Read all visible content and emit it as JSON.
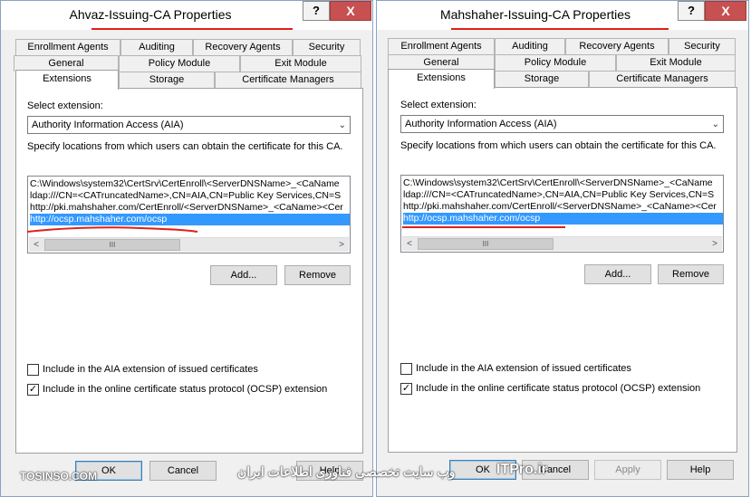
{
  "left_dialog": {
    "title": "Ahvaz-Issuing-CA Properties",
    "help_button": "?",
    "close_button": "X",
    "tabs_row1": [
      "Enrollment Agents",
      "Auditing",
      "Recovery Agents",
      "Security"
    ],
    "tabs_row2": [
      "General",
      "Policy Module",
      "Exit Module"
    ],
    "tabs_row3": [
      "Extensions",
      "Storage",
      "Certificate Managers"
    ],
    "select_extension_label": "Select extension:",
    "select_extension_value": "Authority Information Access (AIA)",
    "specify_text": "Specify locations from which users can obtain the certificate for this CA.",
    "locations": [
      "C:\\Windows\\system32\\CertSrv\\CertEnroll\\<ServerDNSName>_<CaName",
      "ldap:///CN=<CATruncatedName>,CN=AIA,CN=Public Key Services,CN=S",
      "http://pki.mahshaher.com/CertEnroll/<ServerDNSName>_<CaName><Cer",
      "http://ocsp.mahshaher.com/ocsp"
    ],
    "add_button": "Add...",
    "remove_button": "Remove",
    "include_aia_label": "Include in the AIA extension of issued certificates",
    "include_ocsp_label": "Include in the online certificate status protocol (OCSP) extension",
    "ok_button": "OK",
    "cancel_button": "Cancel",
    "help_footer_button": "Help"
  },
  "right_dialog": {
    "title": "Mahshaher-Issuing-CA Properties",
    "help_button": "?",
    "close_button": "X",
    "tabs_row1": [
      "Enrollment Agents",
      "Auditing",
      "Recovery Agents",
      "Security"
    ],
    "tabs_row2": [
      "General",
      "Policy Module",
      "Exit Module"
    ],
    "tabs_row3": [
      "Extensions",
      "Storage",
      "Certificate Managers"
    ],
    "select_extension_label": "Select extension:",
    "select_extension_value": "Authority Information Access (AIA)",
    "specify_text": "Specify locations from which users can obtain the certificate for this CA.",
    "locations": [
      "C:\\Windows\\system32\\CertSrv\\CertEnroll\\<ServerDNSName>_<CaName",
      "ldap:///CN=<CATruncatedName>,CN=AIA,CN=Public Key Services,CN=S",
      "http://pki.mahshaher.com/CertEnroll/<ServerDNSName>_<CaName><Cer",
      "http://ocsp.mahshaher.com/ocsp"
    ],
    "add_button": "Add...",
    "remove_button": "Remove",
    "include_aia_label": "Include in the AIA extension of issued certificates",
    "include_ocsp_label": "Include in the online certificate status protocol (OCSP) extension",
    "ok_button": "OK",
    "cancel_button": "Cancel",
    "apply_button": "Apply",
    "help_footer_button": "Help"
  },
  "checkbox_state": {
    "include_aia": false,
    "include_ocsp": true
  },
  "selected_location_index": 3,
  "scrollbar_thumb_glyph": "III",
  "scroll_left_glyph": "<",
  "scroll_right_glyph": ">",
  "watermark_left": "TOSINSO.COM",
  "watermark_center": "وب سایت تخصصی فناوری اطلاعات ایران",
  "watermark_right": "ITPro.ir",
  "colors": {
    "selection": "#3399ff",
    "annotation_red": "#e0201a",
    "dialog_bg": "#f0f0f0",
    "close_red": "#c75050"
  }
}
